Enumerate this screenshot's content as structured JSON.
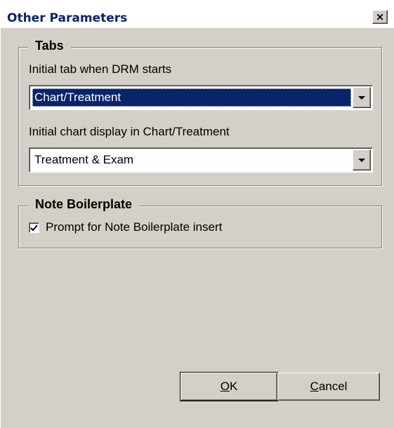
{
  "window": {
    "title": "Other Parameters",
    "close_glyph": "×"
  },
  "tabs_group": {
    "title": "Tabs",
    "initial_tab_label": "Initial tab when DRM starts",
    "initial_tab_value": "Chart/Treatment",
    "initial_chart_label": "Initial chart display in Chart/Treatment",
    "initial_chart_value": "Treatment & Exam"
  },
  "note_group": {
    "title": "Note Boilerplate",
    "prompt_label": "Prompt for Note Boilerplate insert",
    "prompt_checked": true
  },
  "buttons": {
    "ok_accel": "O",
    "ok_rest": "K",
    "cancel_accel": "C",
    "cancel_rest": "ancel"
  },
  "colors": {
    "face": "#d4d0c8",
    "selection": "#0a246a",
    "title_text": "#0a246a"
  }
}
